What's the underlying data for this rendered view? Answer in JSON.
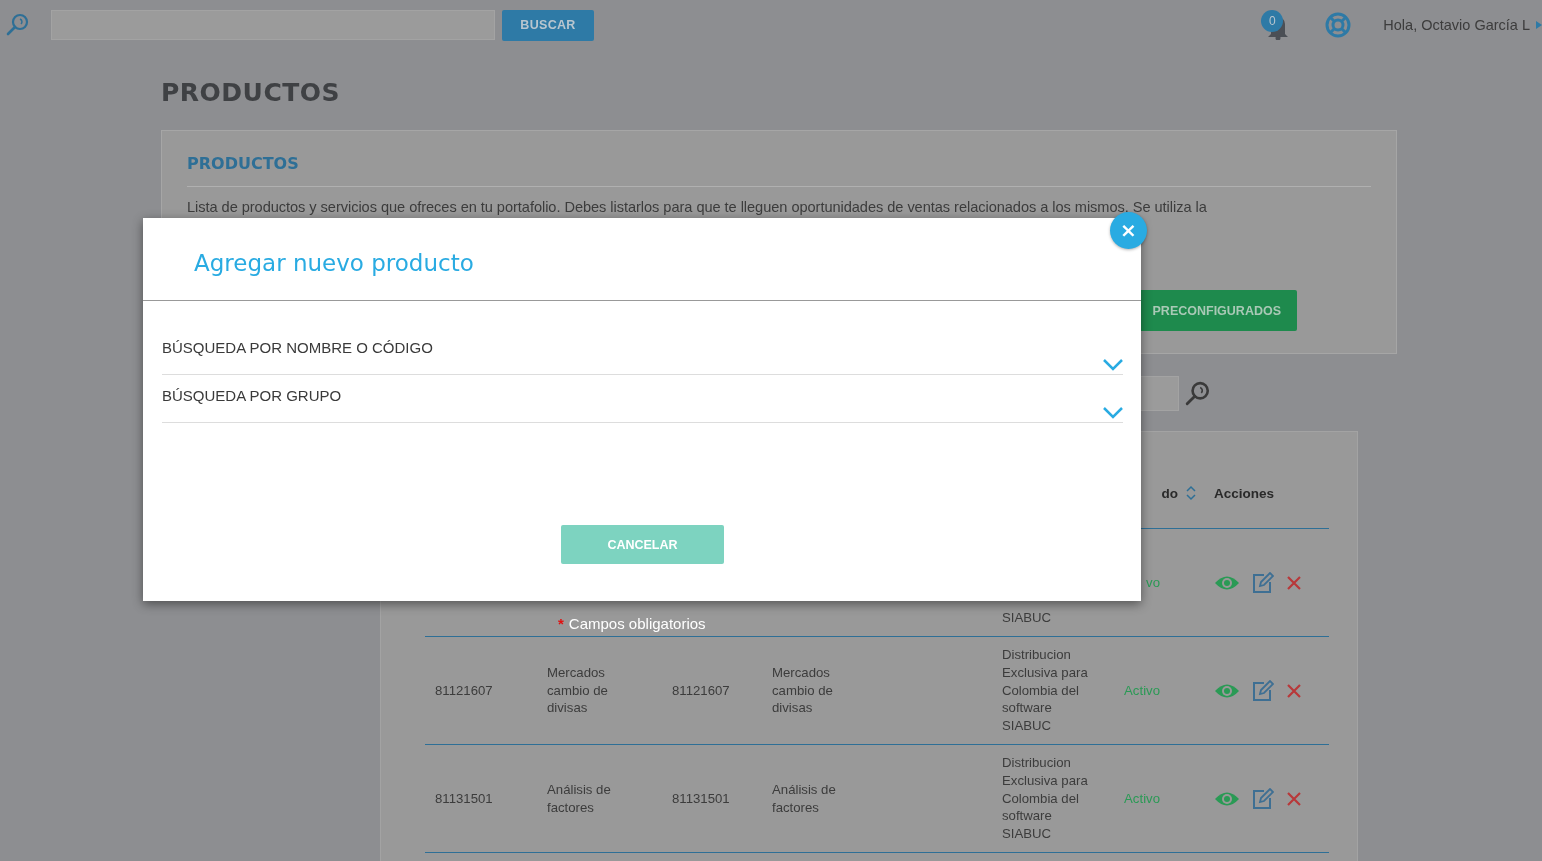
{
  "top_bar": {
    "search_button": "BUSCAR",
    "notifications": {
      "count": "0"
    },
    "user": "Hola, Octavio García L"
  },
  "page_title": "PRODUCTOS",
  "card": {
    "title": "PRODUCTOS",
    "description": "Lista de productos y servicios que ofreces en tu portafolio. Debes listarlos para que te lleguen oportunidades de ventas relacionados a los mismos. Se utiliza la",
    "button": "PRECONFIGURADOS"
  },
  "table": {
    "columns": [
      {
        "label": "do",
        "sortable": true
      },
      {
        "label": "Acciones",
        "sortable": false
      }
    ],
    "rows": [
      {
        "description": "SIABUC",
        "status": "vo"
      },
      {
        "code": "81121607",
        "name": "Mercados cambio de divisas",
        "code_2": "81121607",
        "name_2": "Mercados cambio de divisas",
        "description": "Distribucion Exclusiva para Colombia del software SIABUC",
        "status": "Activo"
      },
      {
        "code": "81131501",
        "name": "Análisis de factores",
        "code_2": "81131501",
        "name_2": "Análisis de factores",
        "description": "Distribucion Exclusiva para Colombia del software SIABUC",
        "status": "Activo"
      }
    ]
  },
  "modal": {
    "title": "Agregar nuevo producto",
    "close": "×",
    "sections": [
      {
        "label": "BÚSQUEDA POR NOMBRE O CÓDIGO",
        "expanded": false
      },
      {
        "label": "BÚSQUEDA POR GRUPO",
        "expanded": false
      }
    ],
    "cancel_button": "CANCELAR",
    "required_mark": "*",
    "required_note": "Campos obligatorios"
  }
}
